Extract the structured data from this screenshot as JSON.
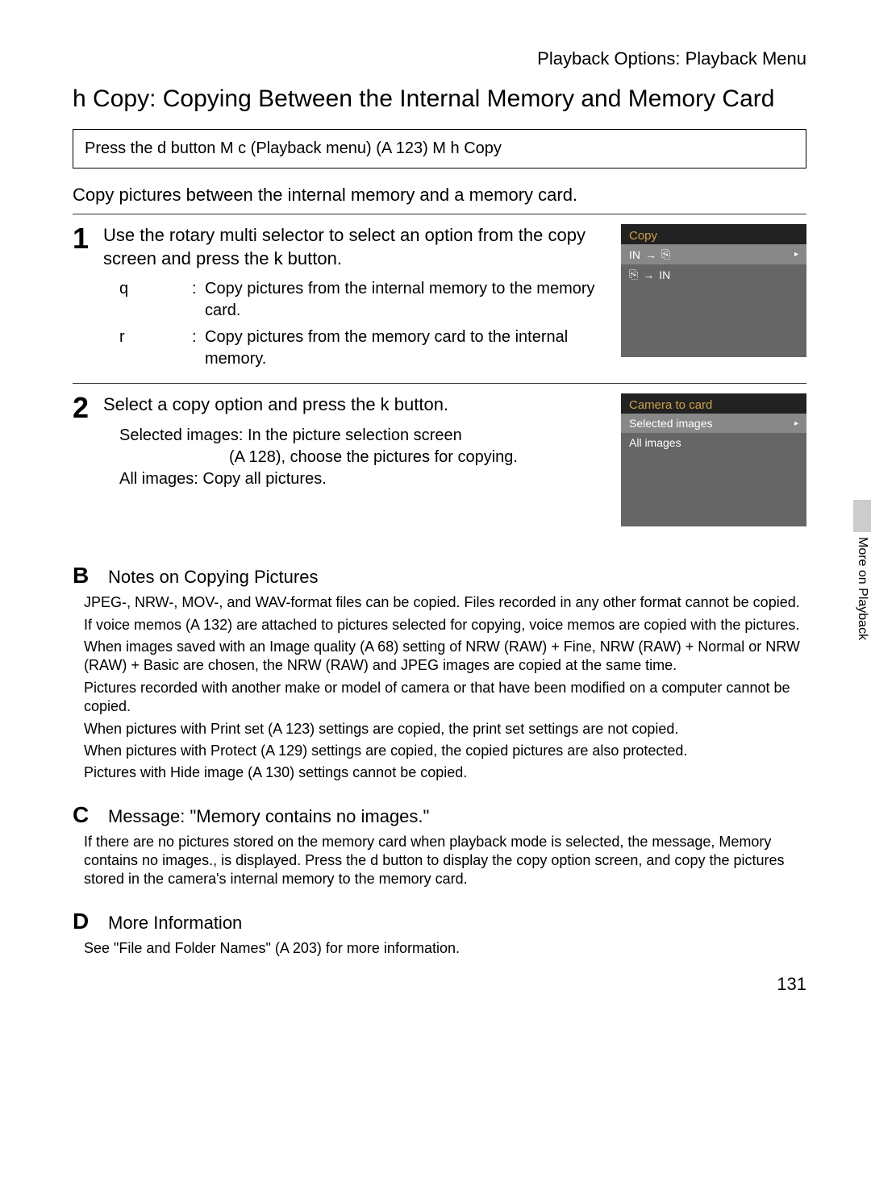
{
  "header": "Playback Options: Playback Menu",
  "section_icon": "h",
  "section_title": "Copy: Copying Between the Internal Memory and Memory Card",
  "nav_path": "Press the d  button M c  (Playback menu) (A 123) M h  Copy",
  "intro": "Copy pictures between the internal memory and a memory card.",
  "steps": [
    {
      "num": "1",
      "main": "Use the rotary multi selector to select an option from the copy screen and press the k button.",
      "subs": [
        {
          "label": "q",
          "text": "Copy pictures from the internal memory to the memory card."
        },
        {
          "label": "r",
          "text": "Copy pictures from the memory card to the internal memory."
        }
      ],
      "screenshot": {
        "title": "Copy",
        "rows": [
          {
            "left": "IN",
            "arrow": "→",
            "right": "⎘",
            "selected": true
          },
          {
            "left": "⎘",
            "arrow": "→",
            "right": "IN",
            "selected": false
          }
        ]
      }
    },
    {
      "num": "2",
      "main": "Select a copy option and press the k button.",
      "subs": [
        {
          "label": "Selected images:",
          "text": "In the picture selection screen (A 128), choose the pictures for copying."
        },
        {
          "label": "All images:",
          "text": "Copy all pictures."
        }
      ],
      "screenshot": {
        "title": "Camera to card",
        "rows": [
          {
            "text": "Selected images",
            "selected": true
          },
          {
            "text": "All images",
            "selected": false
          }
        ]
      }
    }
  ],
  "notes": [
    {
      "icon": "B",
      "title": "Notes on Copying Pictures",
      "lines": [
        "JPEG-, NRW-, MOV-, and WAV-format files can be copied. Files recorded in any other format cannot be copied.",
        "If voice memos (A 132) are attached to pictures selected for copying, voice memos are copied with the pictures.",
        "When images saved with an Image quality (A 68) setting of NRW (RAW) + Fine, NRW (RAW) + Normal or NRW (RAW) + Basic are chosen, the NRW (RAW) and JPEG images are copied at the same time.",
        "Pictures recorded with another make or model of camera or that have been modified on a computer cannot be copied.",
        "When pictures with Print set (A 123) settings are copied, the print set settings are not copied.",
        "When pictures with Protect (A 129) settings are copied, the copied pictures are also protected.",
        "Pictures with Hide image (A 130) settings cannot be copied."
      ]
    },
    {
      "icon": "C",
      "title": "Message: \"Memory contains no images.\"",
      "plain": "If there are no pictures stored on the memory card when playback mode is selected, the message, Memory contains no images., is displayed. Press the d button to display the copy option screen, and copy the pictures stored in the camera's internal memory to the memory card."
    },
    {
      "icon": "D",
      "title": "More Information",
      "plain": "See \"File and Folder Names\" (A 203) for more information."
    }
  ],
  "side_tab": "More on Playback",
  "page_number": "131"
}
